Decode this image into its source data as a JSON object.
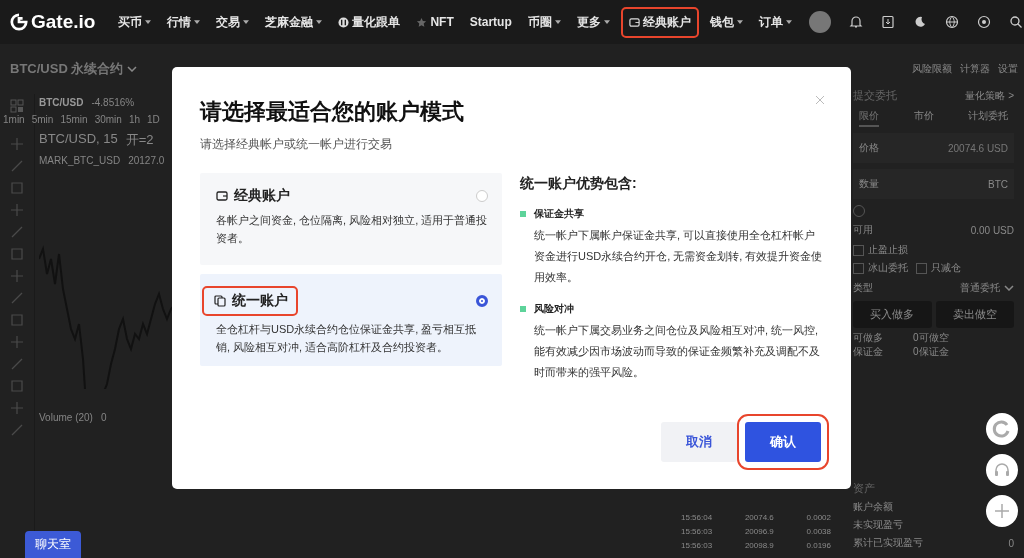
{
  "nav": {
    "logo": "Gate.io",
    "items": [
      {
        "kind": "text",
        "label": "买币",
        "dropdown": true,
        "highlighted": false
      },
      {
        "kind": "text",
        "label": "行情",
        "dropdown": true,
        "highlighted": false
      },
      {
        "kind": "text",
        "label": "交易",
        "dropdown": true,
        "highlighted": false
      },
      {
        "kind": "text",
        "label": "芝麻金融",
        "dropdown": true,
        "highlighted": false
      },
      {
        "kind": "quant",
        "label": "量化跟单",
        "dropdown": false,
        "highlighted": false
      },
      {
        "kind": "nft",
        "label": "NFT",
        "dropdown": false,
        "highlighted": false
      },
      {
        "kind": "text",
        "label": "Startup",
        "dropdown": false,
        "highlighted": false
      },
      {
        "kind": "text",
        "label": "币圈",
        "dropdown": true,
        "highlighted": false
      },
      {
        "kind": "text",
        "label": "更多",
        "dropdown": true,
        "highlighted": false
      },
      {
        "kind": "account",
        "label": "经典账户",
        "dropdown": false,
        "highlighted": true
      },
      {
        "kind": "text",
        "label": "钱包",
        "dropdown": true,
        "highlighted": false
      },
      {
        "kind": "text",
        "label": "订单",
        "dropdown": true,
        "highlighted": false
      }
    ]
  },
  "header": {
    "pair": "BTC/USD 永续合约",
    "tools": [
      "风险限额",
      "计算器",
      "设置"
    ]
  },
  "chart": {
    "symbol": "BTC/USD",
    "change": "-4.8516%",
    "intervals": [
      "1min",
      "5min",
      "15min",
      "30min",
      "1h",
      "1D"
    ],
    "legend": "BTC/USD, 15",
    "open": "开=2",
    "mark": "MARK_BTC_USD",
    "mark_values": [
      "20127.0"
    ],
    "volume": "Volume (20)",
    "volume_value": "0"
  },
  "trades": [
    {
      "time": "15:56:04",
      "price": "20074.6",
      "amount": "0.0002"
    },
    {
      "time": "15:56:03",
      "price": "20096.9",
      "amount": "0.0038"
    },
    {
      "time": "15:56:03",
      "price": "20098.9",
      "amount": "0.0196"
    }
  ],
  "order_panel": {
    "title": "提交委托",
    "link": "量化策略 >",
    "tabs": [
      {
        "label": "限价",
        "selected": true
      },
      {
        "label": "市价",
        "selected": false
      },
      {
        "label": "计划委托",
        "selected": false
      }
    ],
    "price_label": "价格",
    "price_value": "20074.6 USD",
    "amount_label": "数量",
    "amount_unit": "BTC",
    "available_label": "可用",
    "available_value": "0.00 USD",
    "options": [
      {
        "label": "止盈止损",
        "checked": false
      },
      {
        "label": "冰山委托",
        "checked": false
      },
      {
        "label": "只减仓",
        "checked": false
      }
    ],
    "type_label": "类型",
    "type_value": "普通委托",
    "buy": "买入做多",
    "sell": "卖出做空",
    "stats": [
      [
        "可做多",
        "0可做空"
      ],
      [
        "保证金",
        "0保证金"
      ]
    ],
    "assets_title": "资产",
    "assets": [
      "账户余额",
      "未实现盈亏",
      "累计已实现盈亏"
    ],
    "assets_last_value": "0"
  },
  "chat": "聊天室",
  "modal": {
    "title": "请选择最适合您的账户模式",
    "subtitle": "请选择经典帐户或统一帐户进行交易",
    "options": [
      {
        "kind": "classic",
        "title": "经典账户",
        "description": "各帐户之间资金, 仓位隔离, 风险相对独立, 适用于普通投资者。",
        "selected": false,
        "highlighted": false
      },
      {
        "kind": "unified",
        "title": "统一账户",
        "description": "全仓杠杆与USD永续合约仓位保证金共享, 盈亏相互抵销, 风险相互对冲, 适合高阶杠杆及合约投资者。",
        "selected": true,
        "highlighted": true
      }
    ],
    "benefits_heading": "统一账户优势包含:",
    "benefits": [
      {
        "title": "保证金共享",
        "text": "统一帐户下属帐户保证金共享, 可以直接使用全仓杠杆帐户资金进行USD永续合约开仓, 无需资金划转, 有效提升资金使用效率。"
      },
      {
        "title": "风险对冲",
        "text": "统一帐户下属交易业务之间仓位及风险相互对冲, 统一风控, 能有效减少因市场波动而导致的保证金频繁补充及调配不及时而带来的强平风险。"
      }
    ],
    "cancel": {
      "label": "取消",
      "highlighted": false
    },
    "confirm": {
      "label": "确认",
      "highlighted": true
    }
  }
}
